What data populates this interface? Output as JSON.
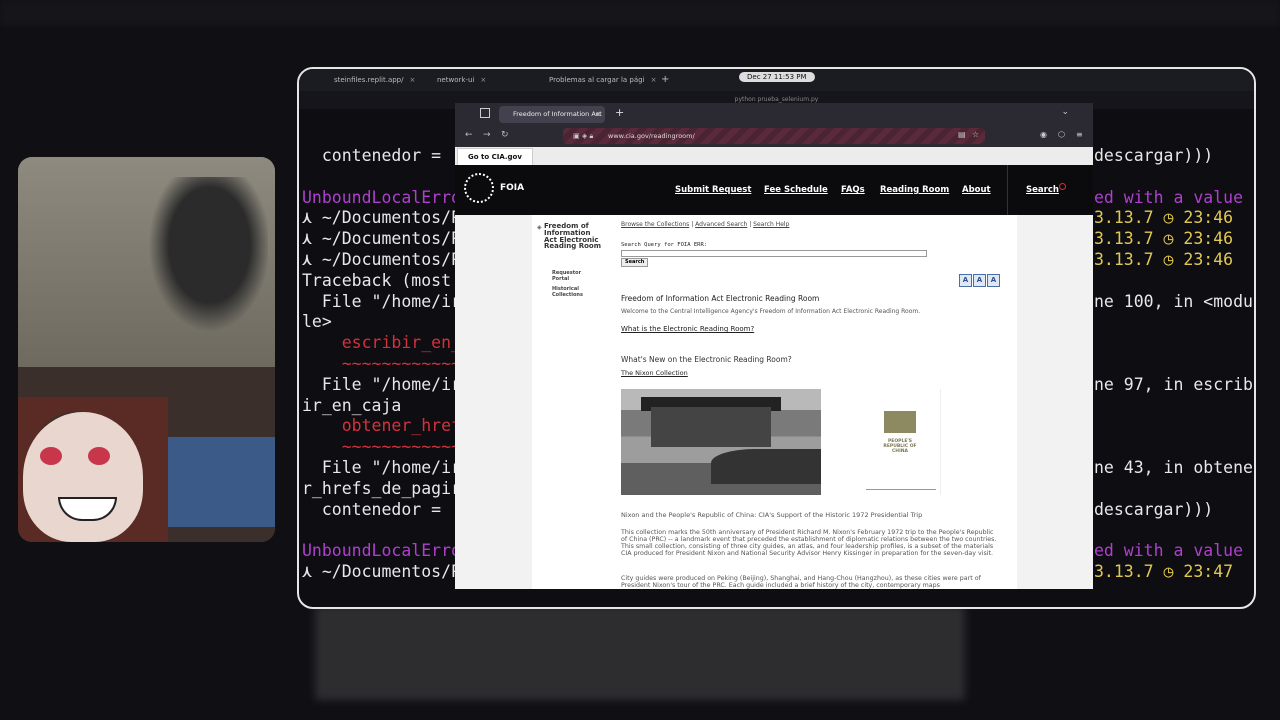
{
  "terminal": {
    "tabs": [
      {
        "label": "steinfiles.replit.app/"
      },
      {
        "label": "network-ui"
      },
      {
        "label": "Problemas al cargar la pági"
      }
    ],
    "clock": "Dec 27  11:53 PM",
    "title": "python prueba_selenium.py",
    "left_lines": [
      "  contenedor =",
      "",
      "UnboundLocalErro",
      "⋏ ~/Documentos/P",
      "⋏ ~/Documentos/P",
      "⋏ ~/Documentos/P",
      "Traceback (most",
      "  File \"/home/ir",
      "le>",
      "    escribir_en_",
      "    ~~~~~~~~~~~~",
      "  File \"/home/ir",
      "ir_en_caja",
      "    obtener_href",
      "    ~~~~~~~~~~~~",
      "  File \"/home/ir",
      "r_hrefs_de_pagir",
      "  contenedor =",
      "",
      "UnboundLocalErro",
      "⋏ ~/Documentos/P"
    ],
    "right_lines": [
      "descargar)))",
      "",
      "ed with a value",
      "3.13.7 ◷ 23:46",
      "3.13.7 ◷ 23:46",
      "3.13.7 ◷ 23:46",
      "",
      "ne 100, in <modu",
      "",
      "",
      "",
      "ne 97, in escrib",
      "",
      "",
      "",
      "ne 43, in obtene",
      "",
      "descargar)))",
      "",
      "ed with a value",
      "3.13.7 ◷ 23:47"
    ]
  },
  "browser": {
    "tab_title": "Freedom of Information Act",
    "url": "www.cia.gov/readingroom/",
    "goto_label": "Go to CIA.gov",
    "logo": "FOIA",
    "nav": [
      "Submit Request",
      "Fee Schedule",
      "FAQs",
      "Reading Room",
      "About"
    ],
    "search_label": "Search",
    "sidebar": {
      "title": "Freedom of Information Act Electronic Reading Room",
      "items": [
        "Requestor Portal",
        "Historical Collections"
      ]
    },
    "top_links": [
      "Browse the Collections",
      "Advanced Search",
      "Search Help"
    ],
    "query_label": "Search Query for FOIA ERR:",
    "search_button": "Search",
    "size_buttons": [
      "A",
      "A",
      "A"
    ],
    "heading": "Freedom of Information Act Electronic Reading Room",
    "welcome": "Welcome to the Central Intelligence Agency's Freedom of Information Act Electronic Reading Room.",
    "what_is": "What is the Electronic Reading Room?",
    "whats_new": "What's New on the Electronic Reading Room?",
    "nixon_link": "The Nixon Collection",
    "book_title": "PEOPLE'S REPUBLIC OF CHINA",
    "caption": "Nixon and the People's Republic of China: CIA's Support of the Historic 1972 Presidential Trip",
    "para1": "This collection marks the 50th anniversary of President Richard M. Nixon's February 1972 trip to the People's Republic of China (PRC) -- a landmark event that preceded the establishment of diplomatic relations between the two countries. This small collection, consisting of three city guides, an atlas, and four leadership profiles, is a subset of the materials CIA produced for President Nixon and National Security Advisor Henry Kissinger in preparation for the seven-day visit.",
    "para2": "City guides were produced on Peking (Beijing), Shanghai, and Hang-Chou (Hangzhou), as these cities were part of President Nixon's tour of the PRC. Each guide included a brief history of the city, contemporary maps"
  }
}
